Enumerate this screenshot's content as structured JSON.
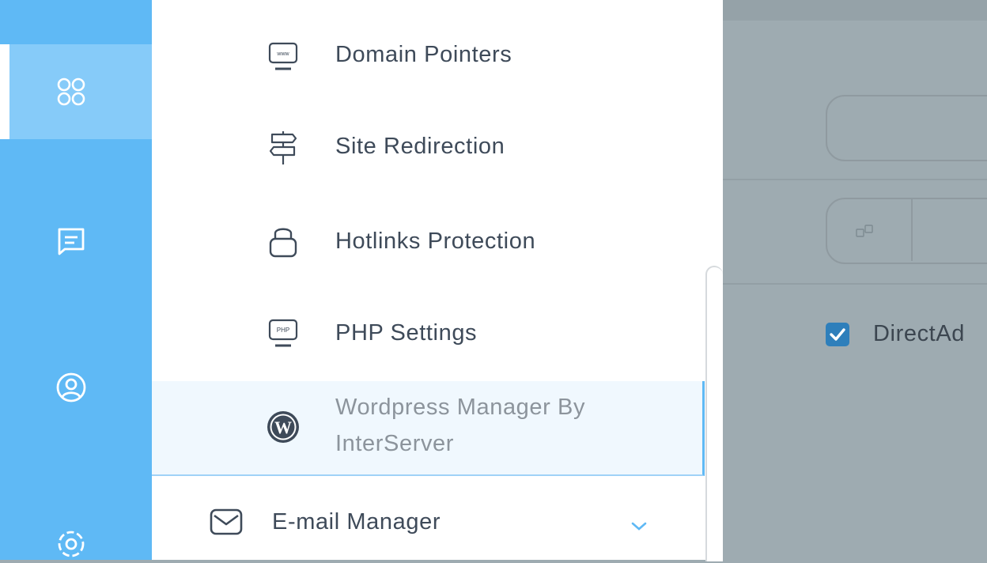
{
  "sidebar_rail": {
    "items": [
      {
        "name": "apps-grid-icon",
        "active": true
      },
      {
        "name": "message-icon",
        "active": false
      },
      {
        "name": "user-icon",
        "active": false
      },
      {
        "name": "settings-gear-icon",
        "active": false
      }
    ]
  },
  "menu": {
    "items": [
      {
        "label": "Domain Pointers",
        "icon": "www-monitor-icon"
      },
      {
        "label": "Site Redirection",
        "icon": "signpost-icon"
      },
      {
        "label": "Hotlinks Protection",
        "icon": "lock-icon"
      },
      {
        "label": "PHP Settings",
        "icon": "php-monitor-icon"
      },
      {
        "label": "Wordpress Manager By InterServer",
        "icon": "wordpress-icon",
        "active": true
      }
    ],
    "email_section": {
      "label": "E-mail Manager",
      "icon": "envelope-icon",
      "expand_icon": "chevron-down-icon"
    }
  },
  "overlay": {
    "checkbox_label": "DirectAd",
    "checkbox_checked": true
  },
  "colors": {
    "rail": "#5fb9f5",
    "rail_active": "#86cbf9",
    "active_item_bg": "#f0f8fe",
    "overlay": "#9eabb1",
    "checkbox": "#2e7fbb",
    "text": "#3e4a59"
  }
}
